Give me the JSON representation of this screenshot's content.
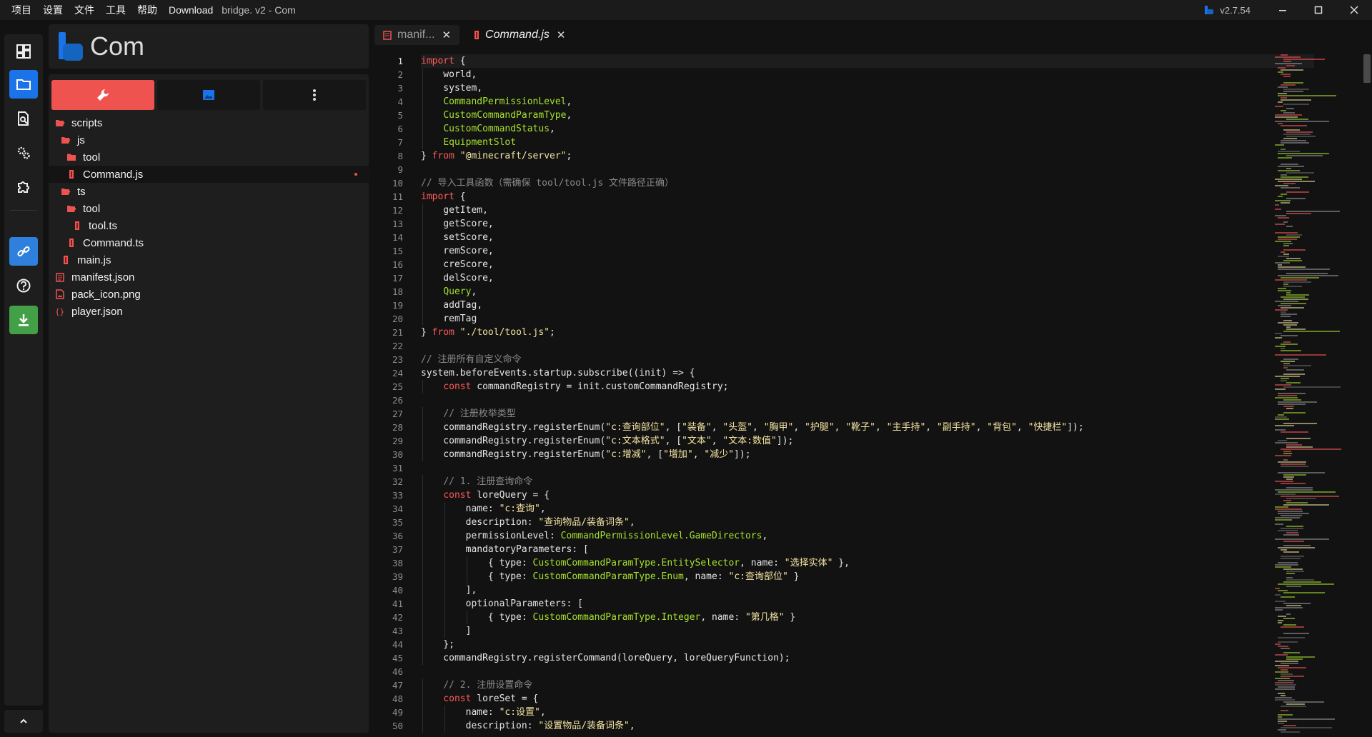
{
  "titlebar": {
    "menu": [
      "项目",
      "设置",
      "文件",
      "工具",
      "帮助",
      "Download"
    ],
    "title": "bridge. v2 - Com",
    "version": "v2.7.54"
  },
  "colors": {
    "accent": "#1a73e8",
    "tool_tab": "#ef5350",
    "link": "#2f7fdc",
    "download": "#43a047"
  },
  "project": {
    "name": "Com"
  },
  "explorer": {
    "tree": [
      {
        "name": "scripts",
        "icon": "folder-open-icon",
        "depth": 0
      },
      {
        "name": "js",
        "icon": "folder-open-icon",
        "depth": 1
      },
      {
        "name": "tool",
        "icon": "folder-icon",
        "depth": 2
      },
      {
        "name": "Command.js",
        "icon": "js-file-icon",
        "depth": 2,
        "selected": true,
        "modified": true
      },
      {
        "name": "ts",
        "icon": "folder-open-icon",
        "depth": 1
      },
      {
        "name": "tool",
        "icon": "folder-open-icon",
        "depth": 2
      },
      {
        "name": "tool.ts",
        "icon": "ts-file-icon",
        "depth": 3
      },
      {
        "name": "Command.ts",
        "icon": "ts-file-icon",
        "depth": 2
      },
      {
        "name": "main.js",
        "icon": "js-file-icon",
        "depth": 1
      },
      {
        "name": "manifest.json",
        "icon": "manifest-icon",
        "depth": 0
      },
      {
        "name": "pack_icon.png",
        "icon": "image-file-icon",
        "depth": 0
      },
      {
        "name": "player.json",
        "icon": "json-file-icon",
        "depth": 0
      }
    ]
  },
  "editor": {
    "tabs": [
      {
        "label": "manif...",
        "active": false
      },
      {
        "label": "Command.js",
        "active": true
      }
    ],
    "current_line": 1,
    "lines": [
      [
        [
          "kw",
          "import"
        ],
        [
          "t",
          " {"
        ]
      ],
      [
        [
          "t",
          "    world,"
        ]
      ],
      [
        [
          "t",
          "    system,"
        ]
      ],
      [
        [
          "t",
          "    "
        ],
        [
          "ty",
          "CommandPermissionLevel"
        ],
        [
          "t",
          ","
        ]
      ],
      [
        [
          "t",
          "    "
        ],
        [
          "ty",
          "CustomCommandParamType"
        ],
        [
          "t",
          ","
        ]
      ],
      [
        [
          "t",
          "    "
        ],
        [
          "ty",
          "CustomCommandStatus"
        ],
        [
          "t",
          ","
        ]
      ],
      [
        [
          "t",
          "    "
        ],
        [
          "ty",
          "EquipmentSlot"
        ]
      ],
      [
        [
          "t",
          "} "
        ],
        [
          "kw",
          "from"
        ],
        [
          "t",
          " "
        ],
        [
          "str",
          "\"@minecraft/server\""
        ],
        [
          "t",
          ";"
        ]
      ],
      [],
      [
        [
          "cm",
          "// 导入工具函数（需确保 tool/tool.js 文件路径正确）"
        ]
      ],
      [
        [
          "kw",
          "import"
        ],
        [
          "t",
          " {"
        ]
      ],
      [
        [
          "t",
          "    getItem,"
        ]
      ],
      [
        [
          "t",
          "    getScore,"
        ]
      ],
      [
        [
          "t",
          "    setScore,"
        ]
      ],
      [
        [
          "t",
          "    remScore,"
        ]
      ],
      [
        [
          "t",
          "    creScore,"
        ]
      ],
      [
        [
          "t",
          "    delScore,"
        ]
      ],
      [
        [
          "t",
          "    "
        ],
        [
          "ty",
          "Query"
        ],
        [
          "t",
          ","
        ]
      ],
      [
        [
          "t",
          "    addTag,"
        ]
      ],
      [
        [
          "t",
          "    remTag"
        ]
      ],
      [
        [
          "t",
          "} "
        ],
        [
          "kw",
          "from"
        ],
        [
          "t",
          " "
        ],
        [
          "str",
          "\"./tool/tool.js\""
        ],
        [
          "t",
          ";"
        ]
      ],
      [],
      [
        [
          "cm",
          "// 注册所有自定义命令"
        ]
      ],
      [
        [
          "t",
          "system.beforeEvents.startup.subscribe((init) => {"
        ]
      ],
      [
        [
          "t",
          "    "
        ],
        [
          "kw",
          "const"
        ],
        [
          "t",
          " commandRegistry = init.customCommandRegistry;"
        ]
      ],
      [],
      [
        [
          "t",
          "    "
        ],
        [
          "cm",
          "// 注册枚举类型"
        ]
      ],
      [
        [
          "t",
          "    commandRegistry.registerEnum("
        ],
        [
          "str",
          "\"c:查询部位\""
        ],
        [
          "t",
          ", ["
        ],
        [
          "str",
          "\"装备\""
        ],
        [
          "t",
          ", "
        ],
        [
          "str",
          "\"头盔\""
        ],
        [
          "t",
          ", "
        ],
        [
          "str",
          "\"胸甲\""
        ],
        [
          "t",
          ", "
        ],
        [
          "str",
          "\"护腿\""
        ],
        [
          "t",
          ", "
        ],
        [
          "str",
          "\"靴子\""
        ],
        [
          "t",
          ", "
        ],
        [
          "str",
          "\"主手持\""
        ],
        [
          "t",
          ", "
        ],
        [
          "str",
          "\"副手持\""
        ],
        [
          "t",
          ", "
        ],
        [
          "str",
          "\"背包\""
        ],
        [
          "t",
          ", "
        ],
        [
          "str",
          "\"快捷栏\""
        ],
        [
          "t",
          "]);"
        ]
      ],
      [
        [
          "t",
          "    commandRegistry.registerEnum("
        ],
        [
          "str",
          "\"c:文本格式\""
        ],
        [
          "t",
          ", ["
        ],
        [
          "str",
          "\"文本\""
        ],
        [
          "t",
          ", "
        ],
        [
          "str",
          "\"文本:数值\""
        ],
        [
          "t",
          "]);"
        ]
      ],
      [
        [
          "t",
          "    commandRegistry.registerEnum("
        ],
        [
          "str",
          "\"c:增减\""
        ],
        [
          "t",
          ", ["
        ],
        [
          "str",
          "\"增加\""
        ],
        [
          "t",
          ", "
        ],
        [
          "str",
          "\"减少\""
        ],
        [
          "t",
          "]);"
        ]
      ],
      [],
      [
        [
          "t",
          "    "
        ],
        [
          "cm",
          "// 1. 注册查询命令"
        ]
      ],
      [
        [
          "t",
          "    "
        ],
        [
          "kw",
          "const"
        ],
        [
          "t",
          " loreQuery = {"
        ]
      ],
      [
        [
          "t",
          "        name: "
        ],
        [
          "str",
          "\"c:查询\""
        ],
        [
          "t",
          ","
        ]
      ],
      [
        [
          "t",
          "        description: "
        ],
        [
          "str",
          "\"查询物品/装备词条\""
        ],
        [
          "t",
          ","
        ]
      ],
      [
        [
          "t",
          "        permissionLevel: "
        ],
        [
          "ty",
          "CommandPermissionLevel.GameDirectors"
        ],
        [
          "t",
          ","
        ]
      ],
      [
        [
          "t",
          "        mandatoryParameters: ["
        ]
      ],
      [
        [
          "t",
          "            { type: "
        ],
        [
          "ty",
          "CustomCommandParamType.EntitySelector"
        ],
        [
          "t",
          ", name: "
        ],
        [
          "str",
          "\"选择实体\""
        ],
        [
          "t",
          " },"
        ]
      ],
      [
        [
          "t",
          "            { type: "
        ],
        [
          "ty",
          "CustomCommandParamType.Enum"
        ],
        [
          "t",
          ", name: "
        ],
        [
          "str",
          "\"c:查询部位\""
        ],
        [
          "t",
          " }"
        ]
      ],
      [
        [
          "t",
          "        ],"
        ]
      ],
      [
        [
          "t",
          "        optionalParameters: ["
        ]
      ],
      [
        [
          "t",
          "            { type: "
        ],
        [
          "ty",
          "CustomCommandParamType.Integer"
        ],
        [
          "t",
          ", name: "
        ],
        [
          "str",
          "\"第几格\""
        ],
        [
          "t",
          " }"
        ]
      ],
      [
        [
          "t",
          "        ]"
        ]
      ],
      [
        [
          "t",
          "    };"
        ]
      ],
      [
        [
          "t",
          "    commandRegistry.registerCommand(loreQuery, loreQueryFunction);"
        ]
      ],
      [],
      [
        [
          "t",
          "    "
        ],
        [
          "cm",
          "// 2. 注册设置命令"
        ]
      ],
      [
        [
          "t",
          "    "
        ],
        [
          "kw",
          "const"
        ],
        [
          "t",
          " loreSet = {"
        ]
      ],
      [
        [
          "t",
          "        name: "
        ],
        [
          "str",
          "\"c:设置\""
        ],
        [
          "t",
          ","
        ]
      ],
      [
        [
          "t",
          "        description: "
        ],
        [
          "str",
          "\"设置物品/装备词条\""
        ],
        [
          "t",
          ","
        ]
      ]
    ]
  }
}
